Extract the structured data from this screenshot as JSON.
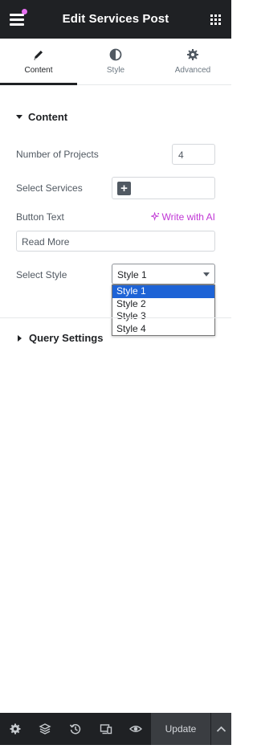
{
  "header": {
    "title": "Edit Services Post",
    "menu_icon": "hamburger-icon",
    "apps_icon": "grid-icon",
    "notification_dot_color": "#e56ff0"
  },
  "tabs": [
    {
      "label": "Content",
      "icon": "pencil-icon",
      "active": true
    },
    {
      "label": "Style",
      "icon": "contrast-icon",
      "active": false
    },
    {
      "label": "Advanced",
      "icon": "gear-icon",
      "active": false
    }
  ],
  "content_section": {
    "title": "Content",
    "number_of_projects": {
      "label": "Number of Projects",
      "value": "4"
    },
    "select_services": {
      "label": "Select Services",
      "add_icon": "+"
    },
    "button_text": {
      "label": "Button Text",
      "ai_link": "Write with AI",
      "value": "Read More"
    },
    "select_style": {
      "label": "Select Style",
      "selected": "Style 1",
      "options": [
        "Style 1",
        "Style 2",
        "Style 3",
        "Style 4"
      ]
    }
  },
  "query_section": {
    "title": "Query Settings"
  },
  "footer": {
    "icons": [
      "settings-icon",
      "layers-icon",
      "history-icon",
      "responsive-icon",
      "preview-icon"
    ],
    "update_label": "Update",
    "expand_icon": "chevron-up-icon"
  },
  "colors": {
    "header_bg": "#1f2124",
    "accent_ai": "#c036d5",
    "selected_option": "#1d63d6"
  }
}
